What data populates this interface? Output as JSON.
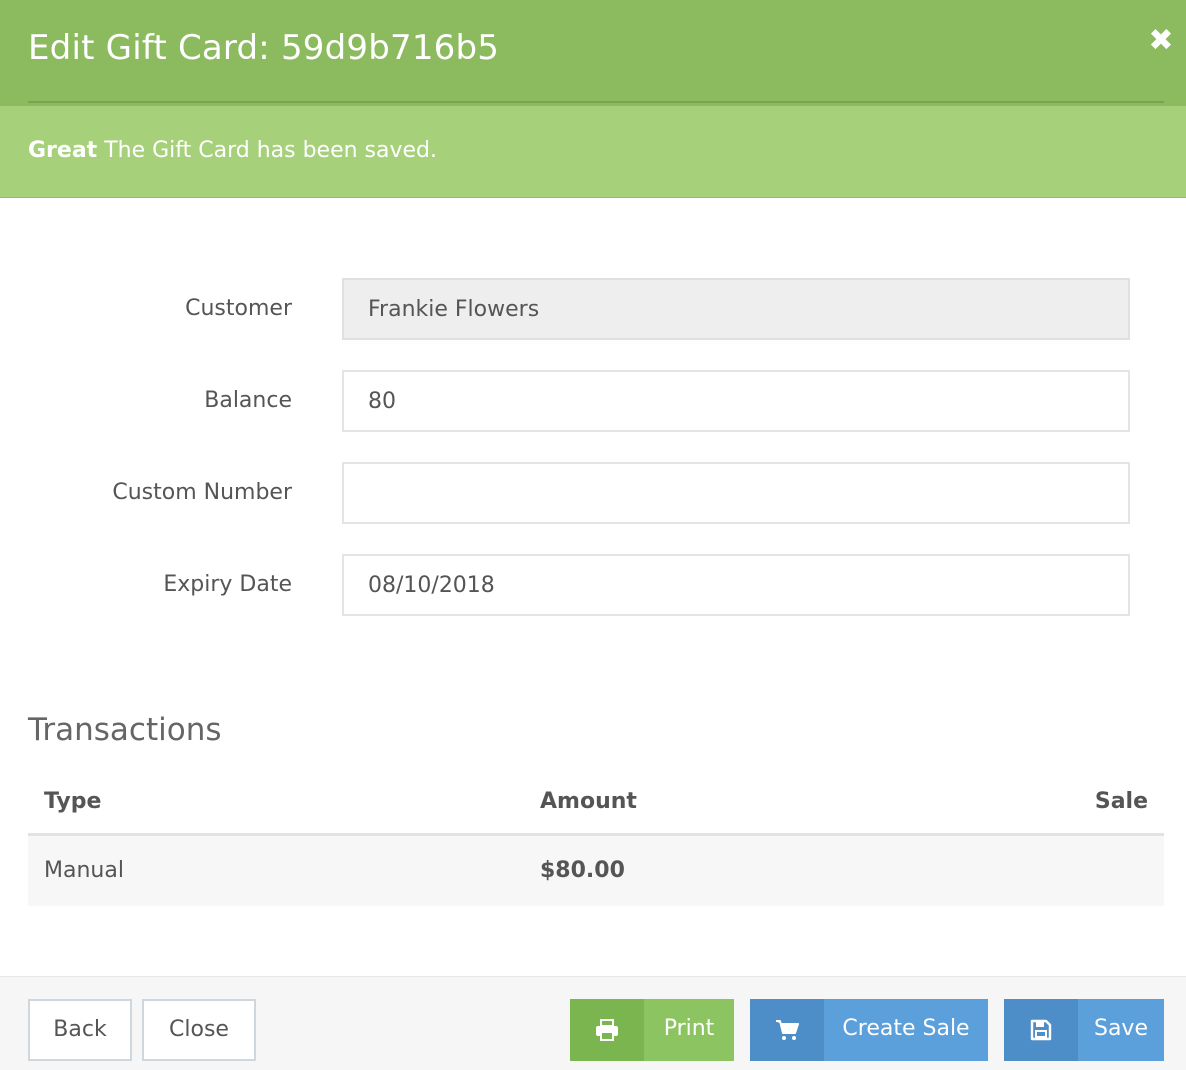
{
  "header": {
    "title": "Edit Gift Card: 59d9b716b5",
    "close_glyph": "✖"
  },
  "alert": {
    "strong": "Great",
    "message": " The Gift Card has been saved."
  },
  "form": {
    "customer": {
      "label": "Customer",
      "value": "Frankie Flowers"
    },
    "balance": {
      "label": "Balance",
      "value": "80"
    },
    "custom_number": {
      "label": "Custom Number",
      "value": ""
    },
    "expiry_date": {
      "label": "Expiry Date",
      "value": "08/10/2018"
    }
  },
  "transactions": {
    "title": "Transactions",
    "columns": [
      "Type",
      "Amount",
      "Sale"
    ],
    "rows": [
      {
        "type": "Manual",
        "amount": "$80.00",
        "sale": ""
      }
    ]
  },
  "footer": {
    "back_label": "Back",
    "close_label": "Close",
    "print_label": "Print",
    "create_sale_label": "Create Sale",
    "save_label": "Save"
  },
  "icons": {
    "close": "close-icon",
    "print": "printer-icon",
    "create_sale": "cart-icon",
    "save": "floppy-disk-icon"
  },
  "colors": {
    "header": "#8cba5f",
    "alert": "#a7d07b",
    "print_button": "#8cc462",
    "primary_button": "#5b9fdb"
  }
}
